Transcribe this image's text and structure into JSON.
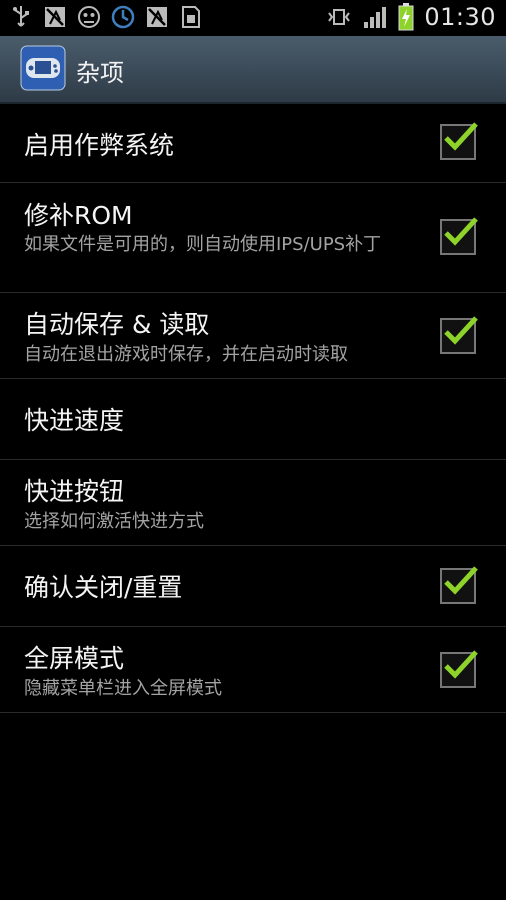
{
  "status_bar": {
    "time": "01:30",
    "icons": [
      "usb-icon",
      "no-sim-icon",
      "android-bug-icon",
      "sync-icon",
      "no-sim-icon",
      "sd-card-icon",
      "vibrate-mute-icon",
      "signal-icon",
      "battery-charging-icon"
    ]
  },
  "action_bar": {
    "title": "杂项",
    "icon": "gba-emulator-icon"
  },
  "settings": {
    "items": [
      {
        "title": "启用作弊系统",
        "subtitle": "",
        "checked": true
      },
      {
        "title": "修补ROM",
        "subtitle": "如果文件是可用的，则自动使用IPS/UPS补丁",
        "checked": true
      },
      {
        "title": "自动保存 & 读取",
        "subtitle": "自动在退出游戏时保存，并在启动时读取",
        "checked": true
      },
      {
        "title": "快进速度",
        "subtitle": "",
        "checked": null
      },
      {
        "title": "快进按钮",
        "subtitle": "选择如何激活快进方式",
        "checked": null
      },
      {
        "title": "确认关闭/重置",
        "subtitle": "",
        "checked": true
      },
      {
        "title": "全屏模式",
        "subtitle": "隐藏菜单栏进入全屏模式",
        "checked": true
      }
    ]
  },
  "colors": {
    "check_green": "#8ed32a",
    "action_bar": "#3c4d5b"
  }
}
